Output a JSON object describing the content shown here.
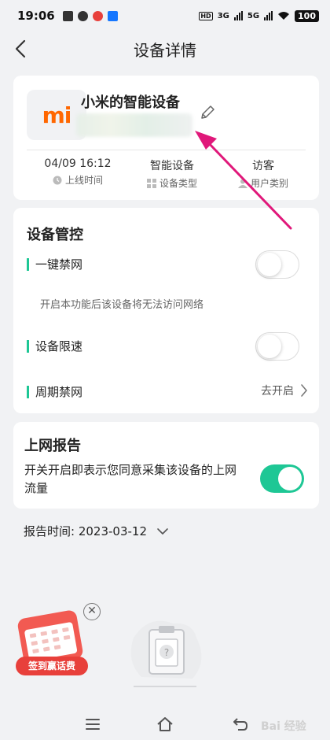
{
  "status_bar": {
    "time": "19:06",
    "network_hd": "HD",
    "network_3g": "3G",
    "network_5g": "5G",
    "battery": "100"
  },
  "header": {
    "title": "设备详情"
  },
  "device": {
    "logo_text": "mi",
    "name": "小米的智能设备",
    "online_time": "04/09 16:12",
    "online_time_label": "上线时间",
    "device_type": "智能设备",
    "device_type_label": "设备类型",
    "user_type": "访客",
    "user_type_label": "用户类别"
  },
  "control": {
    "title": "设备管控",
    "block_internet": {
      "label": "一键禁网",
      "enabled": false,
      "hint": "开启本功能后该设备将无法访问网络"
    },
    "speed_limit": {
      "label": "设备限速",
      "enabled": false
    },
    "periodic_block": {
      "label": "周期禁网",
      "action": "去开启"
    }
  },
  "report": {
    "title": "上网报告",
    "description": "开关开启即表示您同意采集该设备的上网流量",
    "enabled": true,
    "time_label": "报告时间: 2023-03-12"
  },
  "promo": {
    "label": "签到赢话费"
  },
  "watermark": "Bai 经验",
  "colors": {
    "accent": "#1ec795",
    "brand_mi": "#ff6700",
    "promo_red": "#e8403b",
    "annotation": "#e0187a"
  }
}
